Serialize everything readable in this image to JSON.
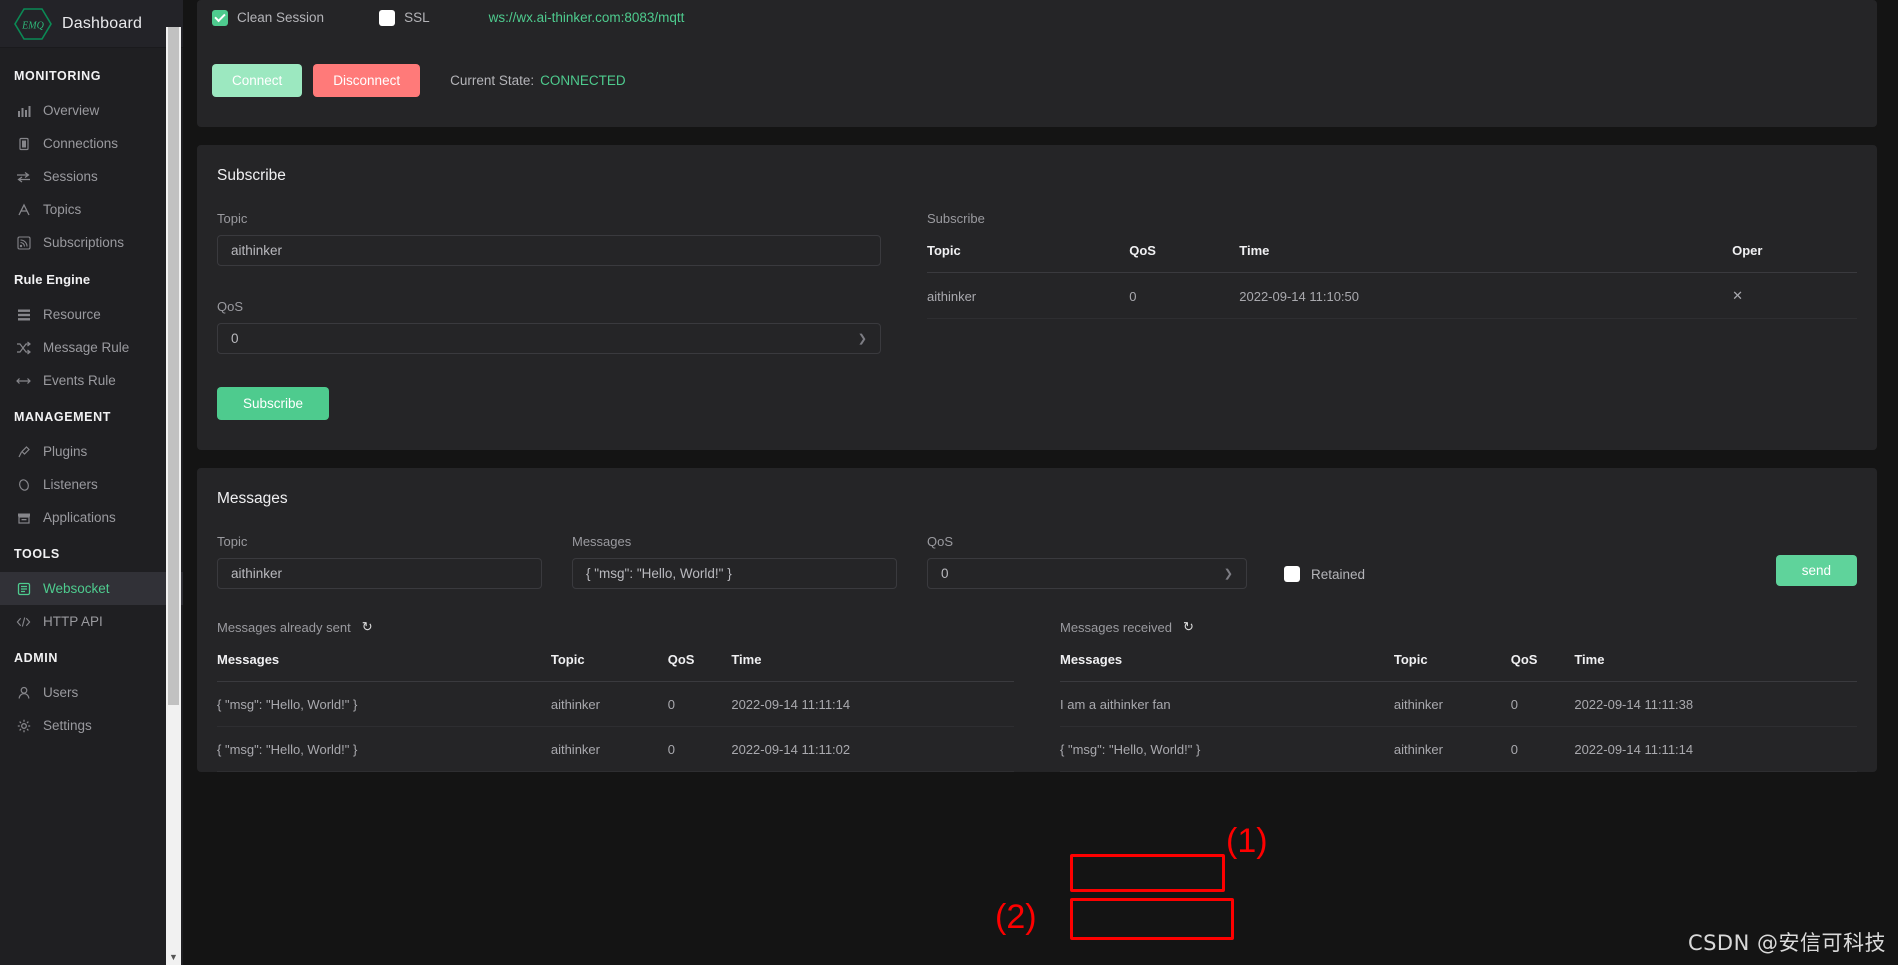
{
  "brand": {
    "logo_text": "EMQ",
    "title": "Dashboard"
  },
  "sidebar": {
    "groups": [
      {
        "label": "MONITORING",
        "style": "upper",
        "items": [
          {
            "label": "Overview",
            "icon": "bar-chart-icon",
            "active": false
          },
          {
            "label": "Connections",
            "icon": "connections-icon",
            "active": false
          },
          {
            "label": "Sessions",
            "icon": "exchange-arrows-icon",
            "active": false
          },
          {
            "label": "Topics",
            "icon": "topics-icon",
            "active": false
          },
          {
            "label": "Subscriptions",
            "icon": "rss-icon",
            "active": false
          }
        ]
      },
      {
        "label": "Rule Engine",
        "style": "mixed",
        "items": [
          {
            "label": "Resource",
            "icon": "layers-icon",
            "active": false
          },
          {
            "label": "Message Rule",
            "icon": "shuffle-icon",
            "active": false
          },
          {
            "label": "Events Rule",
            "icon": "arrows-horizontal-icon",
            "active": false
          }
        ]
      },
      {
        "label": "MANAGEMENT",
        "style": "upper",
        "items": [
          {
            "label": "Plugins",
            "icon": "plug-icon",
            "active": false
          },
          {
            "label": "Listeners",
            "icon": "listener-icon",
            "active": false
          },
          {
            "label": "Applications",
            "icon": "archive-icon",
            "active": false
          }
        ]
      },
      {
        "label": "TOOLS",
        "style": "upper",
        "items": [
          {
            "label": "Websocket",
            "icon": "websocket-icon",
            "active": true
          },
          {
            "label": "HTTP API",
            "icon": "code-icon",
            "active": false
          }
        ]
      },
      {
        "label": "ADMIN",
        "style": "upper",
        "items": [
          {
            "label": "Users",
            "icon": "user-icon",
            "active": false
          },
          {
            "label": "Settings",
            "icon": "gear-icon",
            "active": false
          }
        ]
      }
    ]
  },
  "connection": {
    "clean_session_label": "Clean Session",
    "clean_session_checked": true,
    "ssl_label": "SSL",
    "ssl_checked": false,
    "url": "ws://wx.ai-thinker.com:8083/mqtt",
    "connect_label": "Connect",
    "disconnect_label": "Disconnect",
    "state_label": "Current State:",
    "state_value": "CONNECTED"
  },
  "subscribe": {
    "title": "Subscribe",
    "topic_label": "Topic",
    "topic_value": "aithinker",
    "topic_placeholder": "Topic",
    "qos_label": "QoS",
    "qos_value": "0",
    "button_label": "Subscribe",
    "table_caption": "Subscribe",
    "columns": [
      "Topic",
      "QoS",
      "Time",
      "Oper"
    ],
    "rows": [
      {
        "topic": "aithinker",
        "qos": "0",
        "time": "2022-09-14 11:10:50",
        "oper": "✕"
      }
    ]
  },
  "messages": {
    "title": "Messages",
    "topic_label": "Topic",
    "topic_value": "aithinker",
    "messages_label": "Messages",
    "messages_value": "{ \"msg\": \"Hello, World!\" }",
    "qos_label": "QoS",
    "qos_value": "0",
    "retained_label": "Retained",
    "retained_checked": false,
    "send_label": "send",
    "sent": {
      "caption": "Messages already sent",
      "refresh_icon": "refresh-icon",
      "columns": [
        "Messages",
        "Topic",
        "QoS",
        "Time"
      ],
      "rows": [
        {
          "message": "{ \"msg\": \"Hello, World!\" }",
          "topic": "aithinker",
          "qos": "0",
          "time": "2022-09-14 11:11:14"
        },
        {
          "message": "{ \"msg\": \"Hello, World!\" }",
          "topic": "aithinker",
          "qos": "0",
          "time": "2022-09-14 11:11:02"
        }
      ]
    },
    "received": {
      "caption": "Messages received",
      "refresh_icon": "refresh-icon",
      "columns": [
        "Messages",
        "Topic",
        "QoS",
        "Time"
      ],
      "rows": [
        {
          "message": "I am a aithinker fan",
          "topic": "aithinker",
          "qos": "0",
          "time": "2022-09-14 11:11:38"
        },
        {
          "message": "{ \"msg\": \"Hello, World!\" }",
          "topic": "aithinker",
          "qos": "0",
          "time": "2022-09-14 11:11:14"
        }
      ]
    }
  },
  "annotations": {
    "marker_1": "(1)",
    "marker_2": "(2)",
    "color": "#fe0000"
  },
  "watermark": {
    "text": "CSDN @安信可科技"
  },
  "colors": {
    "accent_green": "#4ecb8e",
    "danger_red": "#ff7a79",
    "page_bg": "#141414",
    "card_bg": "#252527",
    "sidebar_bg": "#1f1f22"
  }
}
